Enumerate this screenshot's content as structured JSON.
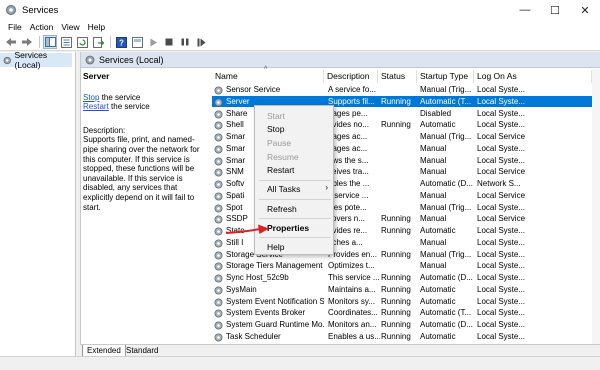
{
  "window": {
    "title": "Services",
    "minimize": "—",
    "maximize": "☐",
    "close": "✕"
  },
  "menu": [
    "File",
    "Action",
    "View",
    "Help"
  ],
  "tree": {
    "root_label": "Services (Local)"
  },
  "panel": {
    "header": "Services (Local)"
  },
  "details": {
    "service_name": "Server",
    "stop_link": "Stop",
    "stop_suffix": " the service",
    "restart_link": "Restart",
    "restart_suffix": " the service",
    "description_label": "Description:",
    "description_text": "Supports file, print, and named-pipe sharing over the network for this computer. If this service is stopped, these functions will be unavailable. If this service is disabled, any services that explicitly depend on it will fail to start."
  },
  "columns": [
    "Name",
    "Description",
    "Status",
    "Startup Type",
    "Log On As"
  ],
  "rows": [
    {
      "name": "Sensor Service",
      "desc": "A service fo...",
      "status": "",
      "startup": "Manual (Trig...",
      "logon": "Local Syste..."
    },
    {
      "name": "Server",
      "desc": "Supports fil...",
      "status": "Running",
      "startup": "Automatic (T...",
      "logon": "Local Syste...",
      "selected": true
    },
    {
      "name": "Share",
      "desc": "nages pe...",
      "status": "",
      "startup": "Disabled",
      "logon": "Local Syste..."
    },
    {
      "name": "Shell",
      "desc": "ovides no...",
      "status": "Running",
      "startup": "Automatic",
      "logon": "Local Syste..."
    },
    {
      "name": "Smar",
      "desc": "nages ac...",
      "status": "",
      "startup": "Manual (Trig...",
      "logon": "Local Service"
    },
    {
      "name": "Smar",
      "desc": "nages ac...",
      "status": "",
      "startup": "Manual",
      "logon": "Local Syste..."
    },
    {
      "name": "Smar",
      "desc": "ows the s...",
      "status": "",
      "startup": "Manual",
      "logon": "Local Syste..."
    },
    {
      "name": "SNM",
      "desc": "ceives tra...",
      "status": "",
      "startup": "Manual",
      "logon": "Local Service"
    },
    {
      "name": "Softv",
      "desc": "ables the ...",
      "status": "",
      "startup": "Automatic (D...",
      "logon": "Network S..."
    },
    {
      "name": "Spati",
      "desc": "s service ...",
      "status": "",
      "startup": "Manual",
      "logon": "Local Service"
    },
    {
      "name": "Spot",
      "desc": "ifies pote...",
      "status": "",
      "startup": "Manual (Trig...",
      "logon": "Local Syste..."
    },
    {
      "name": "SSDP",
      "desc": "covers n...",
      "status": "Running",
      "startup": "Manual",
      "logon": "Local Service"
    },
    {
      "name": "State",
      "desc": "ovides re...",
      "status": "Running",
      "startup": "Automatic",
      "logon": "Local Syste..."
    },
    {
      "name": "Still I",
      "desc": "nches a...",
      "status": "",
      "startup": "Manual",
      "logon": "Local Syste..."
    },
    {
      "name": "Storage Service",
      "desc": "Provides en...",
      "status": "Running",
      "startup": "Manual (Trig...",
      "logon": "Local Syste..."
    },
    {
      "name": "Storage Tiers Management",
      "desc": "Optimizes t...",
      "status": "",
      "startup": "Manual",
      "logon": "Local Syste..."
    },
    {
      "name": "Sync Host_52c9b",
      "desc": "This service ...",
      "status": "Running",
      "startup": "Automatic (D...",
      "logon": "Local Syste..."
    },
    {
      "name": "SysMain",
      "desc": "Maintains a...",
      "status": "Running",
      "startup": "Automatic",
      "logon": "Local Syste..."
    },
    {
      "name": "System Event Notification S...",
      "desc": "Monitors sy...",
      "status": "Running",
      "startup": "Automatic",
      "logon": "Local Syste..."
    },
    {
      "name": "System Events Broker",
      "desc": "Coordinates...",
      "status": "Running",
      "startup": "Automatic (T...",
      "logon": "Local Syste..."
    },
    {
      "name": "System Guard Runtime Mo...",
      "desc": "Monitors an...",
      "status": "Running",
      "startup": "Automatic (D...",
      "logon": "Local Syste..."
    },
    {
      "name": "Task Scheduler",
      "desc": "Enables a us...",
      "status": "Running",
      "startup": "Automatic",
      "logon": "Local Syste..."
    }
  ],
  "context_menu": {
    "start": "Start",
    "stop": "Stop",
    "pause": "Pause",
    "resume": "Resume",
    "restart": "Restart",
    "all_tasks": "All Tasks",
    "all_tasks_arrow": "›",
    "refresh": "Refresh",
    "properties": "Properties",
    "help": "Help"
  },
  "tabs": {
    "extended": "Extended",
    "standard": "Standard"
  },
  "colors": {
    "selection": "#0078d7",
    "link": "#1f55c8",
    "arrow": "#e02020",
    "header_bg": "#dbe4ef"
  }
}
